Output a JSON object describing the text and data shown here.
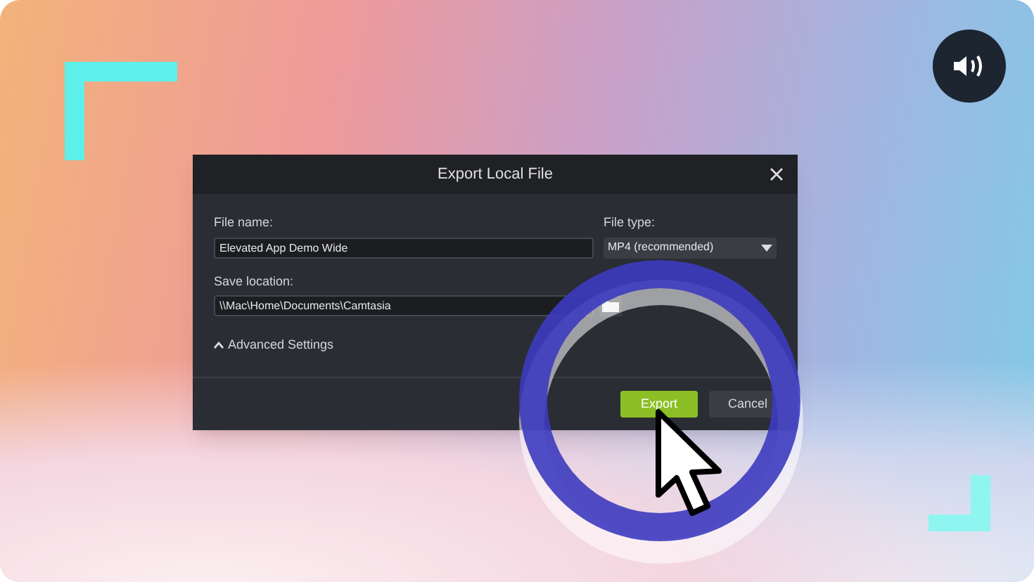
{
  "dialog": {
    "title": "Export Local File",
    "file_name": {
      "label": "File name:",
      "value": "Elevated App Demo Wide"
    },
    "file_type": {
      "label": "File type:",
      "value": "MP4 (recommended)"
    },
    "save_location": {
      "label": "Save location:",
      "value": "\\\\Mac\\Home\\Documents\\Camtasia"
    },
    "advanced_settings": {
      "label": "Advanced Settings",
      "expanded": false
    },
    "buttons": [
      {
        "label": "Export",
        "kind": "primary"
      },
      {
        "label": "Cancel",
        "kind": "secondary"
      }
    ]
  }
}
